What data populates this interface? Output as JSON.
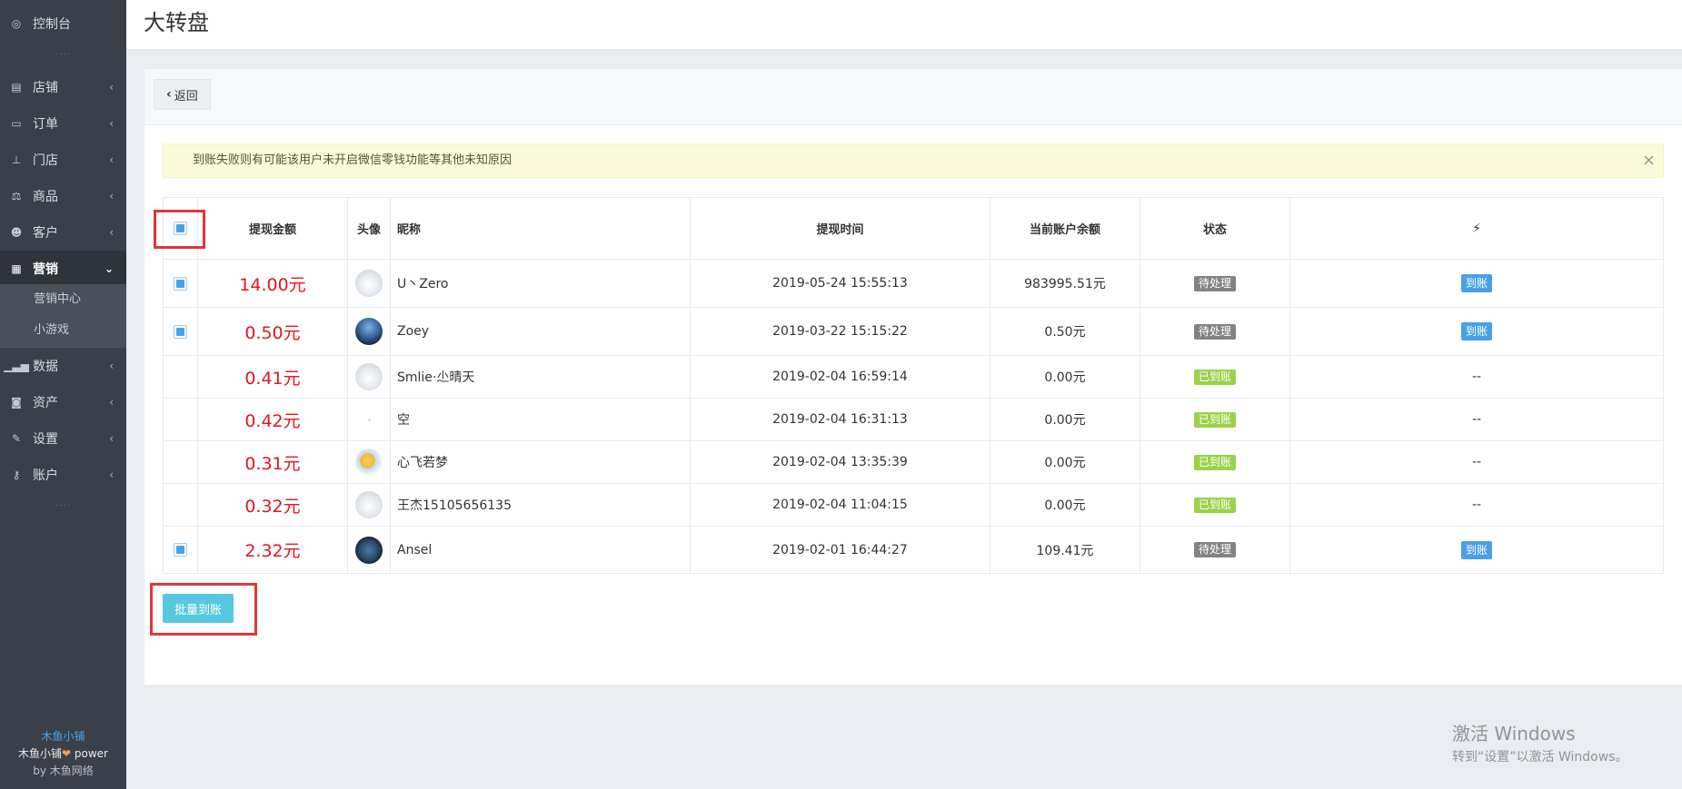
{
  "sidebar": {
    "items": [
      {
        "label": "控制台",
        "icon": "dashboard-icon"
      },
      {
        "label": "店铺",
        "icon": "store-icon"
      },
      {
        "label": "订单",
        "icon": "order-icon"
      },
      {
        "label": "门店",
        "icon": "sitemap-icon"
      },
      {
        "label": "商品",
        "icon": "scale-icon"
      },
      {
        "label": "客户",
        "icon": "users-icon"
      },
      {
        "label": "营销",
        "icon": "gift-icon"
      },
      {
        "label": "数据",
        "icon": "bar-chart-icon"
      },
      {
        "label": "资产",
        "icon": "money-icon"
      },
      {
        "label": "设置",
        "icon": "wrench-icon"
      },
      {
        "label": "账户",
        "icon": "key-icon"
      }
    ],
    "submenu": [
      "营销中心",
      "小游戏"
    ],
    "dots": "....",
    "brand": {
      "name": "木鱼小铺",
      "power_prefix": "木鱼小铺",
      "power_suffix": " power",
      "by": "by 木鱼网络"
    }
  },
  "header": {
    "title": "大转盘"
  },
  "toolbar": {
    "back_label": "返回"
  },
  "alert": {
    "text": "到账失败则有可能该用户未开启微信零钱功能等其他未知原因",
    "close": "×"
  },
  "table": {
    "headers": {
      "amount": "提现金额",
      "avatar": "头像",
      "nickname": "昵称",
      "time": "提现时间",
      "balance": "当前账户余额",
      "status": "状态",
      "action": "⚡"
    },
    "rows": [
      {
        "checkbox": true,
        "amount": "14.00元",
        "avatar": "cloud",
        "nickname": "U丶Zero",
        "time": "2019-05-24 15:55:13",
        "balance": "983995.51元",
        "status": "待处理",
        "status_type": "pending",
        "action": "到账"
      },
      {
        "checkbox": true,
        "amount": "0.50元",
        "avatar": "dark",
        "nickname": "Zoey",
        "time": "2019-03-22 15:15:22",
        "balance": "0.50元",
        "status": "待处理",
        "status_type": "pending",
        "action": "到账"
      },
      {
        "checkbox": false,
        "amount": "0.41元",
        "avatar": "cloud",
        "nickname": "Smlie·尐晴天",
        "time": "2019-02-04 16:59:14",
        "balance": "0.00元",
        "status": "已到账",
        "status_type": "done",
        "action": "--"
      },
      {
        "checkbox": false,
        "amount": "0.42元",
        "avatar": "blank",
        "nickname": "空",
        "time": "2019-02-04 16:31:13",
        "balance": "0.00元",
        "status": "已到账",
        "status_type": "done",
        "action": "--"
      },
      {
        "checkbox": false,
        "amount": "0.31元",
        "avatar": "sun",
        "nickname": "心飞若梦",
        "time": "2019-02-04 13:35:39",
        "balance": "0.00元",
        "status": "已到账",
        "status_type": "done",
        "action": "--"
      },
      {
        "checkbox": false,
        "amount": "0.32元",
        "avatar": "cloud",
        "nickname": "王杰15105656135",
        "time": "2019-02-04 11:04:15",
        "balance": "0.00元",
        "status": "已到账",
        "status_type": "done",
        "action": "--"
      },
      {
        "checkbox": true,
        "amount": "2.32元",
        "avatar": "badge",
        "nickname": "Ansel",
        "time": "2019-02-01 16:44:27",
        "balance": "109.41元",
        "status": "待处理",
        "status_type": "pending",
        "action": "到账"
      }
    ]
  },
  "batch": {
    "label": "批量到账"
  },
  "watermark": {
    "line1": "激活 Windows",
    "line2": "转到“设置”以激活 Windows。"
  },
  "colors": {
    "sidebar_bg": "#3b4048",
    "amount_red": "#e0171f",
    "pay_blue": "#4aa0e6",
    "done_green": "#9bd24a",
    "pending_gray": "#838383",
    "batch_cyan": "#57c8df",
    "highlight_red": "#e3343a"
  }
}
